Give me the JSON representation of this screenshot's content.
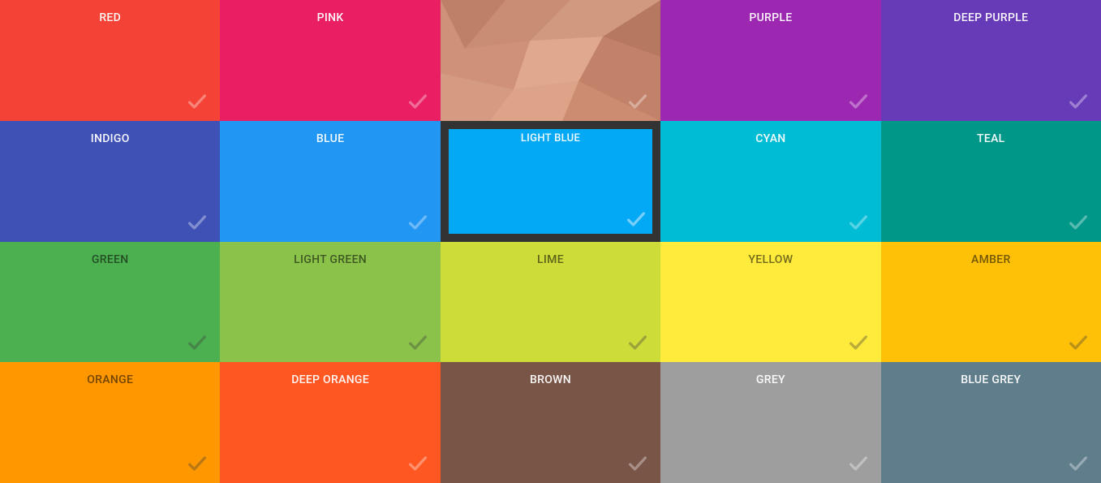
{
  "palette": {
    "tiles": [
      {
        "id": "red",
        "label": "RED",
        "color": "#F44336",
        "textDark": false,
        "selected": false,
        "pattern": false
      },
      {
        "id": "pink",
        "label": "PINK",
        "color": "#E91E63",
        "textDark": false,
        "selected": false,
        "pattern": false
      },
      {
        "id": "pattern",
        "label": "",
        "color": "#C98D73",
        "textDark": false,
        "selected": false,
        "pattern": true
      },
      {
        "id": "purple",
        "label": "PURPLE",
        "color": "#9C27B0",
        "textDark": false,
        "selected": false,
        "pattern": false
      },
      {
        "id": "deep-purple",
        "label": "DEEP PURPLE",
        "color": "#673AB7",
        "textDark": false,
        "selected": false,
        "pattern": false
      },
      {
        "id": "indigo",
        "label": "INDIGO",
        "color": "#3F51B5",
        "textDark": false,
        "selected": false,
        "pattern": false
      },
      {
        "id": "blue",
        "label": "BLUE",
        "color": "#2196F3",
        "textDark": false,
        "selected": false,
        "pattern": false
      },
      {
        "id": "light-blue",
        "label": "LIGHT BLUE",
        "color": "#03A9F4",
        "textDark": false,
        "selected": true,
        "pattern": false
      },
      {
        "id": "cyan",
        "label": "CYAN",
        "color": "#00BCD4",
        "textDark": false,
        "selected": false,
        "pattern": false
      },
      {
        "id": "teal",
        "label": "TEAL",
        "color": "#009688",
        "textDark": false,
        "selected": false,
        "pattern": false
      },
      {
        "id": "green",
        "label": "GREEN",
        "color": "#4CAF50",
        "textDark": true,
        "selected": false,
        "pattern": false
      },
      {
        "id": "light-green",
        "label": "LIGHT GREEN",
        "color": "#8BC34A",
        "textDark": true,
        "selected": false,
        "pattern": false
      },
      {
        "id": "lime",
        "label": "LIME",
        "color": "#CDDC39",
        "textDark": true,
        "selected": false,
        "pattern": false
      },
      {
        "id": "yellow",
        "label": "YELLOW",
        "color": "#FFEB3B",
        "textDark": true,
        "selected": false,
        "pattern": false
      },
      {
        "id": "amber",
        "label": "AMBER",
        "color": "#FFC107",
        "textDark": true,
        "selected": false,
        "pattern": false
      },
      {
        "id": "orange",
        "label": "ORANGE",
        "color": "#FF9800",
        "textDark": true,
        "selected": false,
        "pattern": false
      },
      {
        "id": "deep-orange",
        "label": "DEEP ORANGE",
        "color": "#FF5722",
        "textDark": false,
        "selected": false,
        "pattern": false
      },
      {
        "id": "brown",
        "label": "BROWN",
        "color": "#795548",
        "textDark": false,
        "selected": false,
        "pattern": false
      },
      {
        "id": "grey",
        "label": "GREY",
        "color": "#9E9E9E",
        "textDark": false,
        "selected": false,
        "pattern": false
      },
      {
        "id": "blue-grey",
        "label": "BLUE GREY",
        "color": "#607D8B",
        "textDark": false,
        "selected": false,
        "pattern": false
      }
    ]
  }
}
